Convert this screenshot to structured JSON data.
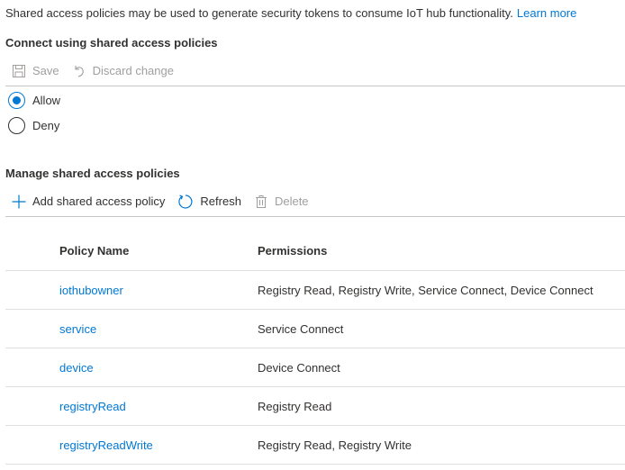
{
  "intro": {
    "text": "Shared access policies may be used to generate security tokens to consume IoT hub functionality.",
    "learn_more": "Learn more"
  },
  "connect_section": {
    "title": "Connect using shared access policies",
    "toolbar": {
      "save_label": "Save",
      "discard_label": "Discard change"
    },
    "options": [
      {
        "label": "Allow",
        "selected": true
      },
      {
        "label": "Deny",
        "selected": false
      }
    ]
  },
  "manage_section": {
    "title": "Manage shared access policies",
    "toolbar": {
      "add_label": "Add shared access policy",
      "refresh_label": "Refresh",
      "delete_label": "Delete"
    },
    "table": {
      "headers": {
        "name": "Policy Name",
        "permissions": "Permissions"
      },
      "rows": [
        {
          "name": "iothubowner",
          "permissions": "Registry Read, Registry Write, Service Connect, Device Connect"
        },
        {
          "name": "service",
          "permissions": "Service Connect"
        },
        {
          "name": "device",
          "permissions": "Device Connect"
        },
        {
          "name": "registryRead",
          "permissions": "Registry Read"
        },
        {
          "name": "registryReadWrite",
          "permissions": "Registry Read, Registry Write"
        }
      ]
    }
  },
  "colors": {
    "accent": "#0078d4",
    "text": "#323130",
    "disabled": "#a19f9d",
    "divider": "#c8c6c4"
  },
  "icons": {
    "save": "save-icon",
    "discard": "undo-icon",
    "add": "plus-icon",
    "refresh": "refresh-icon",
    "delete": "trash-icon"
  }
}
